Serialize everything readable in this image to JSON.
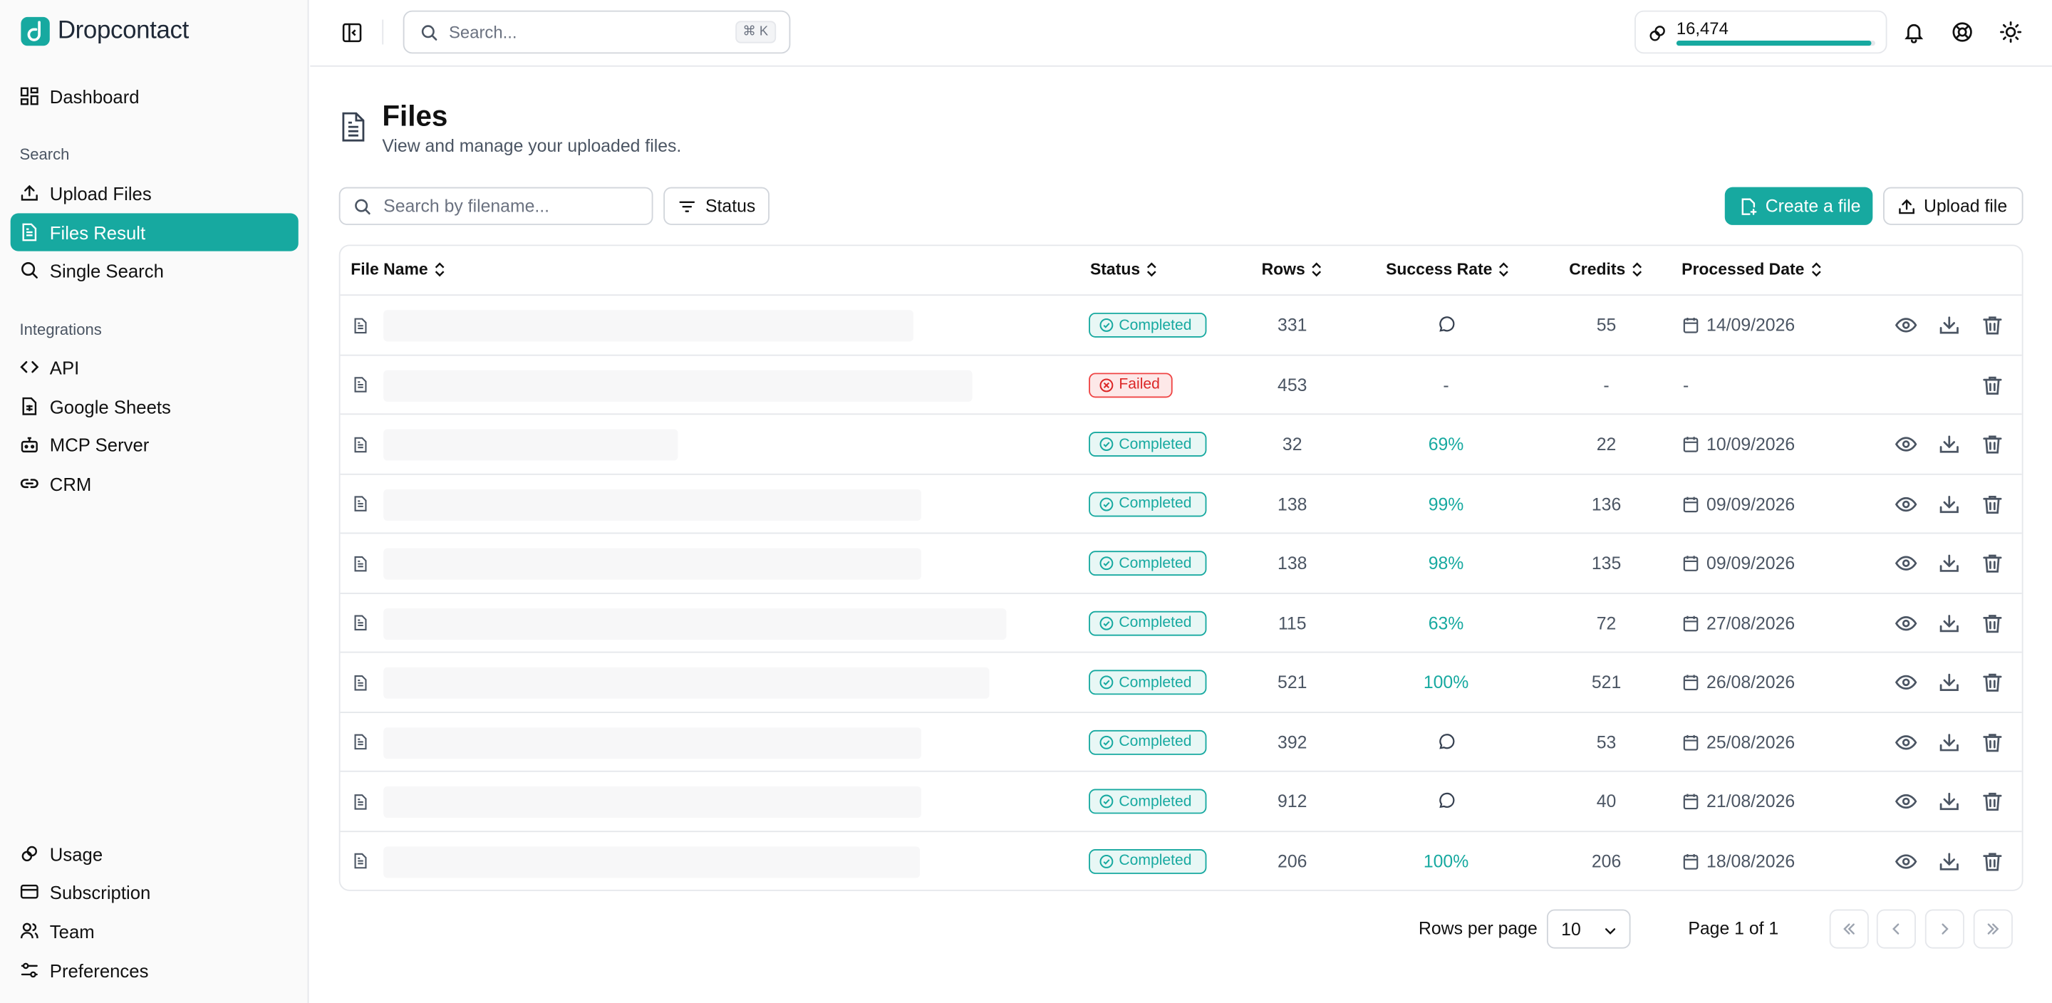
{
  "brand": {
    "name": "Dropcontact"
  },
  "sidebar": {
    "top": [
      {
        "label": "Dashboard",
        "icon": "dashboard-icon"
      }
    ],
    "search_section": "Search",
    "search_items": [
      {
        "label": "Upload Files",
        "icon": "upload-icon"
      },
      {
        "label": "Files Result",
        "icon": "file-icon",
        "active": true
      },
      {
        "label": "Single Search",
        "icon": "search-icon"
      }
    ],
    "integrations_section": "Integrations",
    "integration_items": [
      {
        "label": "API",
        "icon": "code-icon"
      },
      {
        "label": "Google Sheets",
        "icon": "sheet-icon"
      },
      {
        "label": "MCP Server",
        "icon": "bot-icon"
      },
      {
        "label": "CRM",
        "icon": "link-icon"
      }
    ],
    "bottom_items": [
      {
        "label": "Usage",
        "icon": "usage-icon"
      },
      {
        "label": "Subscription",
        "icon": "card-icon"
      },
      {
        "label": "Team",
        "icon": "team-icon"
      },
      {
        "label": "Preferences",
        "icon": "sliders-icon"
      }
    ]
  },
  "topbar": {
    "search_placeholder": "Search...",
    "shortcut": "⌘ K",
    "credits": "16,474",
    "credits_level": 0.98
  },
  "page": {
    "title": "Files",
    "subtitle": "View and manage your uploaded files."
  },
  "toolbar": {
    "filter_placeholder": "Search by filename...",
    "status_label": "Status",
    "create_label": "Create a file",
    "upload_label": "Upload file"
  },
  "table": {
    "columns": [
      "File Name",
      "Status",
      "Rows",
      "Success Rate",
      "Credits",
      "Processed Date"
    ],
    "rows": [
      {
        "status": "Completed",
        "rows": "331",
        "rate": "",
        "credits": "55",
        "date": "14/09/2026"
      },
      {
        "status": "Failed",
        "rows": "453",
        "rate": "-",
        "credits": "-",
        "date": "-"
      },
      {
        "status": "Completed",
        "rows": "32",
        "rate": "69%",
        "credits": "22",
        "date": "10/09/2026"
      },
      {
        "status": "Completed",
        "rows": "138",
        "rate": "99%",
        "credits": "136",
        "date": "09/09/2026"
      },
      {
        "status": "Completed",
        "rows": "138",
        "rate": "98%",
        "credits": "135",
        "date": "09/09/2026"
      },
      {
        "status": "Completed",
        "rows": "115",
        "rate": "63%",
        "credits": "72",
        "date": "27/08/2026"
      },
      {
        "status": "Completed",
        "rows": "521",
        "rate": "100%",
        "credits": "521",
        "date": "26/08/2026"
      },
      {
        "status": "Completed",
        "rows": "392",
        "rate": "",
        "credits": "53",
        "date": "25/08/2026"
      },
      {
        "status": "Completed",
        "rows": "912",
        "rate": "",
        "credits": "40",
        "date": "21/08/2026"
      },
      {
        "status": "Completed",
        "rows": "206",
        "rate": "100%",
        "credits": "206",
        "date": "18/08/2026"
      }
    ]
  },
  "pagination": {
    "rows_per_page_label": "Rows per page",
    "rows_per_page": "10",
    "page_info": "Page 1 of 1"
  }
}
